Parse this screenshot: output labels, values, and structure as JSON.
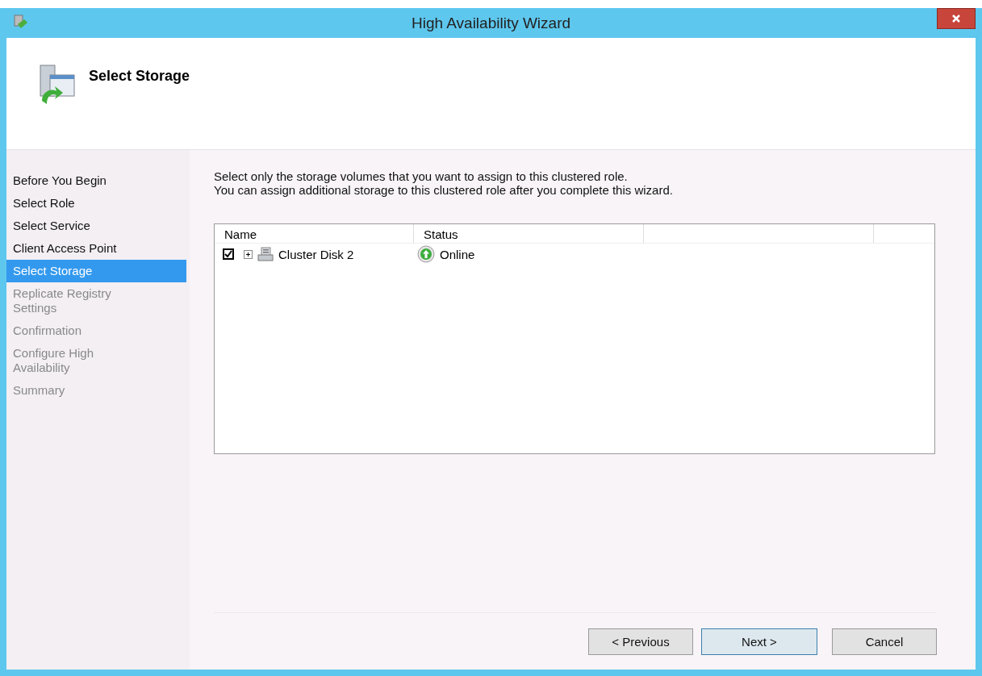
{
  "window": {
    "title": "High Availability Wizard"
  },
  "header": {
    "title": "Select Storage"
  },
  "steps": [
    {
      "label": "Before You Begin",
      "selected": false,
      "disabled": false
    },
    {
      "label": "Select Role",
      "selected": false,
      "disabled": false
    },
    {
      "label": "Select Service",
      "selected": false,
      "disabled": false
    },
    {
      "label": "Client Access Point",
      "selected": false,
      "disabled": false
    },
    {
      "label": "Select Storage",
      "selected": true,
      "disabled": false
    },
    {
      "label": "Replicate Registry Settings",
      "selected": false,
      "disabled": true
    },
    {
      "label": "Confirmation",
      "selected": false,
      "disabled": true
    },
    {
      "label": "Configure High Availability",
      "selected": false,
      "disabled": true
    },
    {
      "label": "Summary",
      "selected": false,
      "disabled": true
    }
  ],
  "instructions": [
    "Select only the storage volumes that you want to assign to this clustered role.",
    "You can assign additional storage to this clustered role after you complete this wizard."
  ],
  "table": {
    "columns": [
      "Name",
      "Status"
    ],
    "rows": [
      {
        "name": "Cluster Disk 2",
        "status": "Online",
        "checked": true,
        "expanded": false
      }
    ]
  },
  "buttons": [
    {
      "label": "< Previous",
      "kind": "normal"
    },
    {
      "label": "Next >",
      "kind": "default"
    },
    {
      "label": "Cancel",
      "kind": "normal"
    }
  ]
}
